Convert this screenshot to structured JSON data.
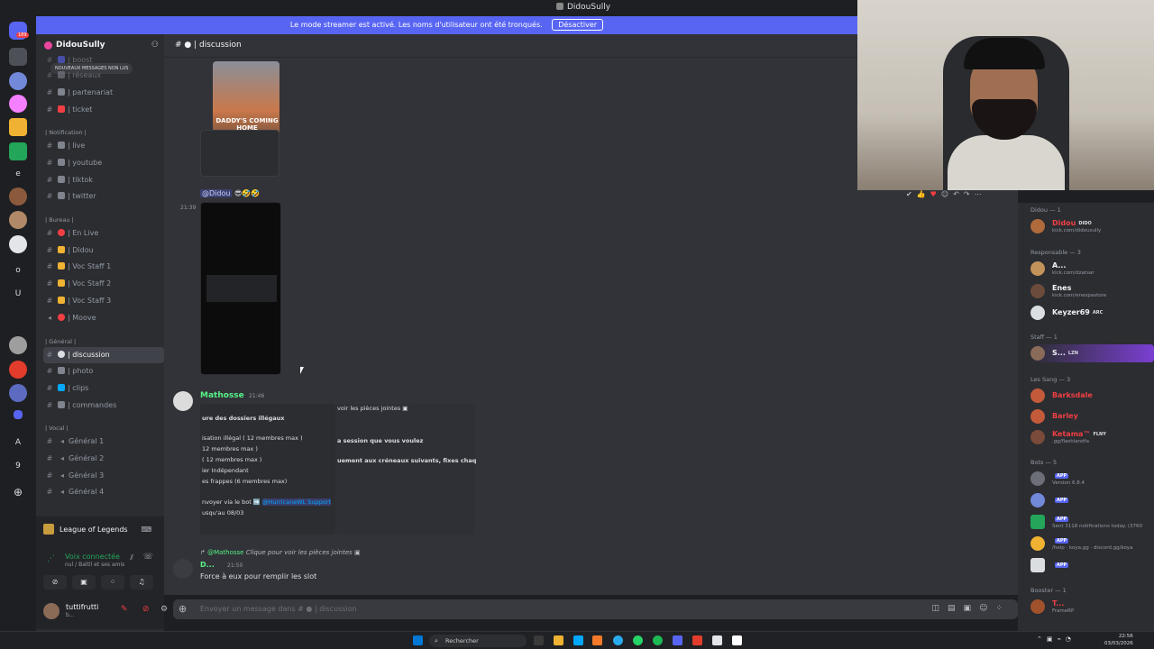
{
  "window": {
    "title": "DidouSully",
    "streamer_banner": "Le mode streamer est activé. Les noms d'utilisateur ont été tronqués.",
    "streamer_button": "Désactiver"
  },
  "guilds": {
    "badge": "189",
    "letters": [
      "e",
      "o",
      "U",
      "A",
      "9"
    ]
  },
  "server": {
    "name": "DidouSully",
    "unread_pill": "NOUVEAUX MESSAGES NON LUS"
  },
  "channels_top": [
    {
      "name": "| boost"
    },
    {
      "name": "| réseaux"
    },
    {
      "name": "| partenariat"
    },
    {
      "name": "| ticket"
    }
  ],
  "categories": {
    "notification": "| Notification |",
    "bureau": "| Bureau |",
    "general": "| Général |",
    "vocal": "| Vocal |"
  },
  "channels_notification": [
    {
      "name": "| live"
    },
    {
      "name": "| youtube"
    },
    {
      "name": "| tiktok"
    },
    {
      "name": "| twitter"
    }
  ],
  "channels_bureau": [
    {
      "name": "| En Live"
    },
    {
      "name": "| Didou"
    },
    {
      "name": "| Voc Staff 1"
    },
    {
      "name": "| Voc Staff 2"
    },
    {
      "name": "| Voc Staff 3"
    },
    {
      "name": "| Moove"
    }
  ],
  "channels_general": [
    {
      "name": "| discussion"
    },
    {
      "name": "| photo"
    },
    {
      "name": "| clips"
    },
    {
      "name": "| commandes"
    }
  ],
  "channels_vocal": [
    {
      "name": "Général 1"
    },
    {
      "name": "Général 2"
    },
    {
      "name": "Général 3"
    },
    {
      "name": "Général 4"
    }
  ],
  "voice_panel": {
    "game": "League of Legends",
    "status": "Voix connectée",
    "sub": "nul / Baltil et ses amis",
    "user_name": "tuttifrutti",
    "user_status": "b..."
  },
  "chat": {
    "channel_name": "| discussion",
    "image_caption": "DADDY'S COMING HOME",
    "mention_1": "@Didou",
    "time_1": "21:39",
    "author_2": "Mathosse",
    "time_2": "21:46",
    "reply_snippet": "voir les pièces jointes",
    "embed_lines": [
      "ure des dossiers illégaux",
      "isation illégal ( 12 membres max )",
      "12 membres max )",
      "( 12 membres max )",
      "ier Indépendant",
      "es frappes (6 membres max)",
      "nvoyer via le bot",
      "usqu'au 08/03"
    ],
    "embed_link": "@HurricaneWL Support",
    "embed_right_1": "a session que vous voulez",
    "embed_right_2": "uement aux créneaux suivants, fixes chaq",
    "reply_name": "@Mathosse",
    "reply_text": "Clique pour voir les pièces jointes",
    "author_3": "D...",
    "time_3": "21:50",
    "message_3": "Force à eux pour remplir les slot",
    "composer_placeholder": "Envoyer un message dans #",
    "composer_channel": "| discussion"
  },
  "members": {
    "cat_didou": "Didou — 1",
    "cat_resp": "Responsable — 3",
    "cat_staff": "Staff — 1",
    "cat_sang": "Les Sang — 3",
    "cat_bots": "Bots — 5",
    "cat_booster": "Booster — 1",
    "list": [
      {
        "name": "Didou",
        "sub": "kick.com/didousully",
        "tag": "DIDO",
        "color": "#f23f43"
      },
      {
        "name": "A...",
        "sub": "kick.com/dzatsar",
        "tag": "",
        "color": "#f2f3f5"
      },
      {
        "name": "Enes",
        "sub": "kick.com/enespastore",
        "tag": "",
        "color": "#f2f3f5"
      },
      {
        "name": "Keyzer69",
        "sub": "",
        "tag": "ARC",
        "color": "#f2f3f5"
      },
      {
        "name": "S...",
        "sub": "",
        "tag": "LZN",
        "color": "#f2f3f5"
      },
      {
        "name": "Barksdale",
        "sub": "",
        "tag": "",
        "color": "#f23f43"
      },
      {
        "name": "Barley",
        "sub": "",
        "tag": "",
        "color": "#f23f43"
      },
      {
        "name": "Ketama™",
        "sub": ".gg/flashlandfa",
        "tag": "FLNY",
        "color": "#f23f43"
      },
      {
        "name": "",
        "sub": "Version 6.8.4",
        "tag": "APP",
        "color": "#949ba4"
      },
      {
        "name": "",
        "sub": "",
        "tag": "APP",
        "color": "#949ba4"
      },
      {
        "name": "",
        "sub": "Sent 3118 notifications today. (3760",
        "tag": "APP",
        "color": "#949ba4"
      },
      {
        "name": "",
        "sub": "/help · koya.gg · discord.gg/koya",
        "tag": "APP",
        "color": "#949ba4"
      },
      {
        "name": "",
        "sub": "",
        "tag": "APP",
        "color": "#949ba4"
      },
      {
        "name": "T...",
        "sub": "FrameRP",
        "tag": "",
        "color": "#f23f43"
      }
    ]
  },
  "taskbar": {
    "search": "Rechercher",
    "time": "22:56",
    "date": "03/03/2026"
  }
}
